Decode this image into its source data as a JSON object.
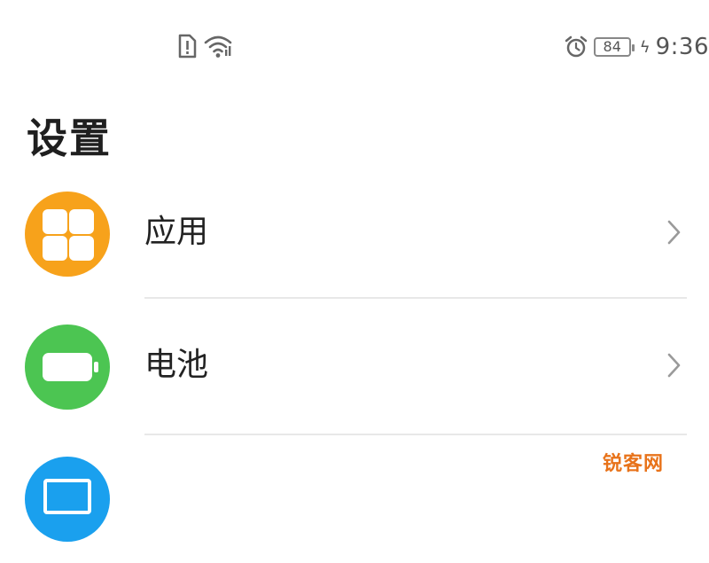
{
  "status_bar": {
    "time": "9:36",
    "battery_level": "84",
    "left_icons": [
      "sim-alert-icon",
      "wifi-icon"
    ],
    "right_icons": [
      "alarm-icon",
      "battery-icon",
      "charging-icon"
    ]
  },
  "page": {
    "title": "设置"
  },
  "settings_items": [
    {
      "label": "应用",
      "icon": "apps-grid-icon",
      "color": "#f7a21b"
    },
    {
      "label": "电池",
      "icon": "battery-icon",
      "color": "#4cc552"
    },
    {
      "label": "",
      "icon": "display-icon",
      "color": "#1aa0ee"
    }
  ],
  "watermark": {
    "text": "锐客网"
  },
  "colors": {
    "divider": "#e8e8e8",
    "chevron": "#9a9a9a"
  }
}
